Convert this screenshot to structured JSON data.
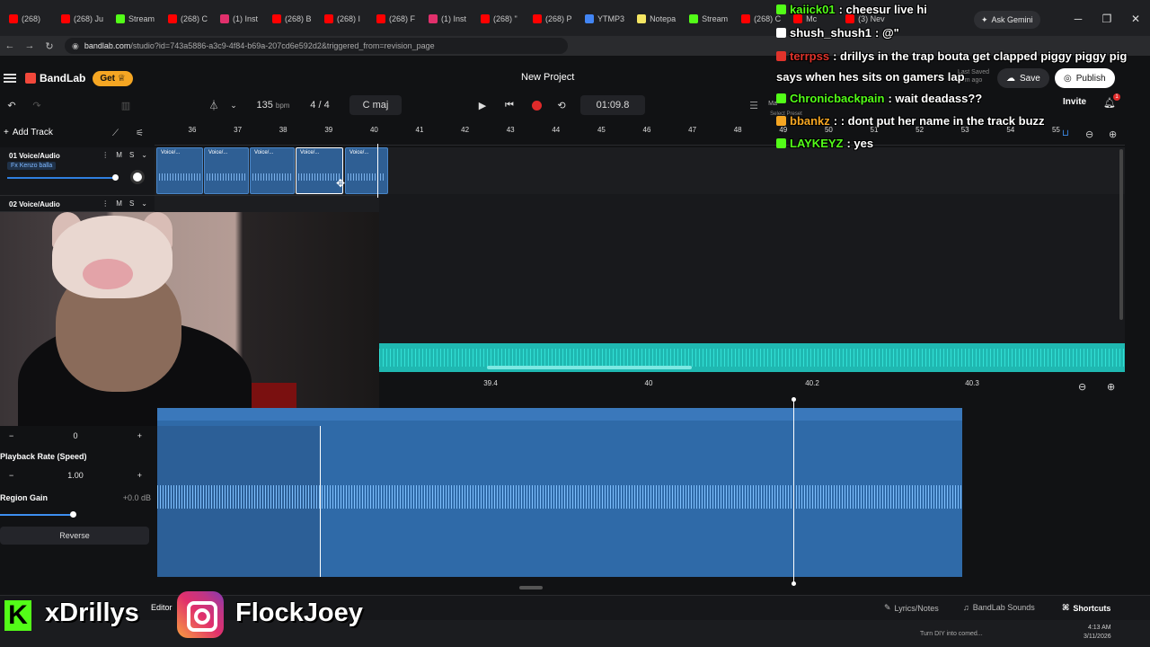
{
  "browser": {
    "tabs": [
      {
        "label": "(268)",
        "color": "#ff0000"
      },
      {
        "label": "(268) Ju",
        "color": "#ff0000"
      },
      {
        "label": "Stream",
        "color": "#53fc18"
      },
      {
        "label": "(268) C",
        "color": "#ff0000"
      },
      {
        "label": "(1) Inst",
        "color": "#e1306c"
      },
      {
        "label": "(268) B",
        "color": "#ff0000"
      },
      {
        "label": "(268) I",
        "color": "#ff0000"
      },
      {
        "label": "(268) F",
        "color": "#ff0000"
      },
      {
        "label": "(1) Inst",
        "color": "#e1306c"
      },
      {
        "label": "(268) \"",
        "color": "#ff0000"
      },
      {
        "label": "(268) P",
        "color": "#ff0000"
      },
      {
        "label": "YTMP3",
        "color": "#4285f4"
      },
      {
        "label": "Notepa",
        "color": "#f5e663"
      },
      {
        "label": "Stream",
        "color": "#53fc18"
      },
      {
        "label": "(268) C",
        "color": "#ff0000"
      },
      {
        "label": "Mc",
        "color": "#ff0000"
      },
      {
        "label": "(3) Nev",
        "color": "#ff0000"
      }
    ],
    "url_host": "bandlab.com",
    "url_path": "/studio?id=743a5886-a3c9-4f84-b69a-207cd6e592d2&triggered_from=revision_page",
    "ask_gemini": "Ask Gemini"
  },
  "header": {
    "brand": "BandLab",
    "get_label": "Get",
    "project_title": "New Project",
    "last_saved": "Last Saved\n29m ago",
    "save_label": "Save",
    "publish_label": "Publish"
  },
  "transport": {
    "bpm": "135",
    "bpm_unit": "bpm",
    "time_sig": "4 / 4",
    "key": "C maj",
    "time": "01:09.8",
    "invite": "Invite",
    "notif_count": "1",
    "master_label": "Ma",
    "select_preset": "Select Preset"
  },
  "timeline": {
    "add_track": "Add Track",
    "bars": [
      "36",
      "37",
      "38",
      "39",
      "40",
      "41",
      "42",
      "43",
      "44",
      "45",
      "46",
      "47",
      "48",
      "49",
      "50",
      "51",
      "52",
      "53",
      "54",
      "55"
    ]
  },
  "tracks": [
    {
      "name": "01  Voice/Audio",
      "fx": "Fx Kenzo balla",
      "m": "M",
      "s": "S"
    },
    {
      "name": "02  Voice/Audio",
      "m": "M",
      "s": "S"
    }
  ],
  "regions": [
    {
      "label": "Voice/..."
    },
    {
      "label": "Voice/..."
    },
    {
      "label": "Voice/..."
    },
    {
      "label": "Voice/..."
    },
    {
      "label": "Voice/..."
    }
  ],
  "editor": {
    "ruler": [
      "39.4",
      "40",
      "40.2",
      "40.3"
    ],
    "pitch_value": "0",
    "playback_rate_title": "Playback Rate (Speed)",
    "playback_rate_value": "1.00",
    "region_gain_title": "Region Gain",
    "region_gain_value": "+0.0 dB",
    "reverse_label": "Reverse",
    "editor_tab": "Editor"
  },
  "bottombar": {
    "lyrics": "Lyrics/Notes",
    "sounds": "BandLab Sounds",
    "shortcuts": "Shortcuts"
  },
  "overlay": {
    "kick_name": "xDrillys",
    "ig_name": "FlockJoey"
  },
  "chat": [
    {
      "user": "kaiick01",
      "user_color": "#53fc18",
      "text": ": cheesur live hi"
    },
    {
      "user": "shush_shush1",
      "user_color": "#ffffff",
      "text": ": @\""
    },
    {
      "user": "terrpss",
      "user_color": "#e0332b",
      "text": ": drillys in the trap bouta get clapped piggy piggy pig"
    },
    {
      "user": "",
      "user_color": "#ffffff",
      "text": "says when hes sits on gamers lap"
    },
    {
      "user": "Chronicbackpain",
      "user_color": "#53fc18",
      "text": ": wait deadass??"
    },
    {
      "user": "bbankz",
      "user_color": "#f5a623",
      "text": ": : dont put her name in the track buzz"
    },
    {
      "user": "LAYKEYZ",
      "user_color": "#53fc18",
      "text": ": yes"
    }
  ],
  "taskbar": {
    "news": "Turn DIY into comed...",
    "time": "4:13 AM",
    "date": "3/11/2026"
  },
  "colors": {
    "region_blue": "#2f6aa8",
    "overview_teal": "#1fb8b1",
    "record_red": "#e02a2a",
    "get_orange": "#f5a623"
  }
}
